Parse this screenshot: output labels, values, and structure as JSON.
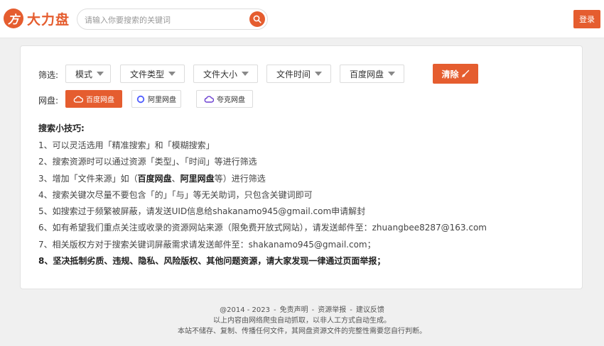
{
  "header": {
    "logo_mark": "方",
    "logo_text": "大力盘",
    "search_placeholder": "请输入你要搜索的关键词",
    "search_value": "",
    "login_label": "登录"
  },
  "filters": {
    "label": "筛选:",
    "items": [
      {
        "label": "模式"
      },
      {
        "label": "文件类型"
      },
      {
        "label": "文件大小"
      },
      {
        "label": "文件时间"
      },
      {
        "label": "百度网盘"
      }
    ],
    "clear_label": "清除"
  },
  "disks": {
    "label": "网盘:",
    "items": [
      {
        "label": "百度网盘",
        "active": true
      },
      {
        "label": "阿里网盘",
        "active": false
      },
      {
        "label": "夸克网盘",
        "active": false
      }
    ]
  },
  "tips": {
    "title": "搜索小技巧:",
    "lines": {
      "l1": "1、可以灵活选用「精准搜索」和「模糊搜索」",
      "l2": "2、搜索资源时可以通过资源「类型」、「时间」等进行筛选",
      "l3_a": "3、增加「文件来源」如（",
      "l3_b": "百度网盘",
      "l3_c": "、",
      "l3_d": "阿里网盘",
      "l3_e": "等）进行筛选",
      "l4": "4、搜索关键次尽量不要包含「的」「与」等无关助词，只包含关键词即可",
      "l5": "5、如搜索过于频繁被屏蔽，请发送UID信息给shakanamo945@gmail.com申请解封",
      "l6": "6、如有希望我们重点关注或收录的资源网站来源（限免费开放式网站），请发送邮件至：zhuangbee8287@163.com",
      "l7": "7、相关版权方对于搜索关键词屏蔽需求请发送邮件至：shakanamo945@gmail.com；",
      "l8": "8、坚决抵制劣质、违规、隐私、风险版权、其他问题资源，请大家发现一律通过页面举报；"
    }
  },
  "footer": {
    "copyright": "@2014 - 2023",
    "disclaimer": "免责声明",
    "report": "资源举报",
    "feedback": "建议反馈",
    "sep": "-",
    "note1": "以上内容由网络爬虫自动抓取，以非人工方式自动生成。",
    "note2": "本站不储存、复制、传播任何文件，其网盘资源文件的完整性需要您自行判断。"
  },
  "colors": {
    "accent": "#e55d2f",
    "panel_bg": "#ffffff",
    "page_bg": "#f0f0f0"
  }
}
